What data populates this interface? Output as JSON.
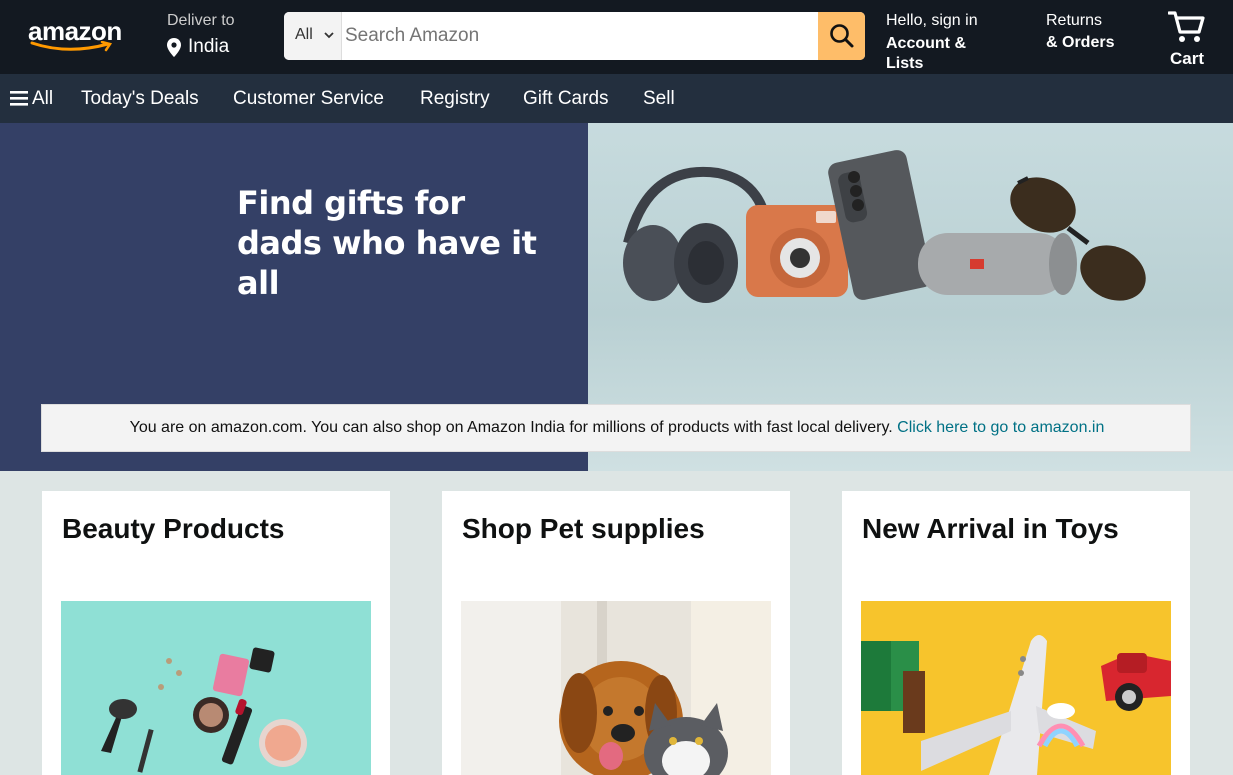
{
  "header": {
    "logo_text": "amazon",
    "deliver_label": "Deliver to",
    "deliver_location": "India",
    "search": {
      "category": "All",
      "placeholder": "Search Amazon",
      "value": ""
    },
    "account_greeting": "Hello, sign in",
    "account_label": "Account & Lists",
    "returns_label": "Returns",
    "orders_label": "& Orders",
    "cart_label": "Cart"
  },
  "subnav": {
    "all_label": "All",
    "items": [
      "Today's Deals",
      "Customer Service",
      "Registry",
      "Gift Cards",
      "Sell"
    ]
  },
  "hero": {
    "title_line1": "Find gifts for",
    "title_line2": "dads who have it all"
  },
  "notice": {
    "text": "You are on amazon.com. You can also shop on Amazon India for millions of products with fast local delivery. ",
    "link": "Click here to go to amazon.in"
  },
  "cards": [
    {
      "title": "Beauty Products"
    },
    {
      "title": "Shop Pet supplies"
    },
    {
      "title": "New Arrival in Toys"
    }
  ],
  "colors": {
    "header_bg": "#131921",
    "subnav_bg": "#232f3e",
    "search_button": "#febd69",
    "hero_left": "#344066",
    "link": "#007185"
  }
}
